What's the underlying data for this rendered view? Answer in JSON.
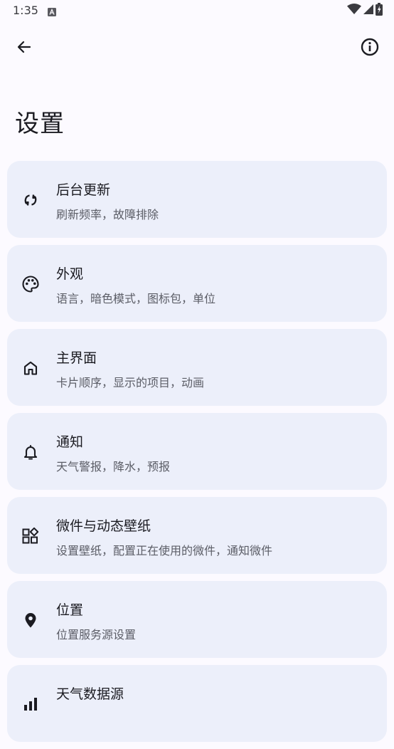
{
  "status_bar": {
    "time": "1:35",
    "notification_icon": "a-icon",
    "icons": [
      "wifi-icon",
      "signal-icon",
      "battery-icon"
    ]
  },
  "app_bar": {
    "back_icon": "arrow-back-icon",
    "info_icon": "info-icon"
  },
  "page": {
    "title": "设置"
  },
  "settings": {
    "items": [
      {
        "icon": "sync-icon",
        "title": "后台更新",
        "subtitle": "刷新频率，故障排除"
      },
      {
        "icon": "palette-icon",
        "title": "外观",
        "subtitle": "语言，暗色模式，图标包，单位"
      },
      {
        "icon": "home-icon",
        "title": "主界面",
        "subtitle": "卡片顺序，显示的项目，动画"
      },
      {
        "icon": "bell-icon",
        "title": "通知",
        "subtitle": "天气警报，降水，预报"
      },
      {
        "icon": "widgets-icon",
        "title": "微件与动态壁纸",
        "subtitle": "设置壁纸，配置正在使用的微件，通知微件"
      },
      {
        "icon": "location-pin-icon",
        "title": "位置",
        "subtitle": "位置服务源设置"
      },
      {
        "icon": "chart-icon",
        "title": "天气数据源",
        "subtitle": ""
      }
    ]
  },
  "colors": {
    "background": "#fcfaff",
    "card": "#eceffa",
    "text_primary": "#1b1b21",
    "text_secondary": "#5b5d66"
  }
}
